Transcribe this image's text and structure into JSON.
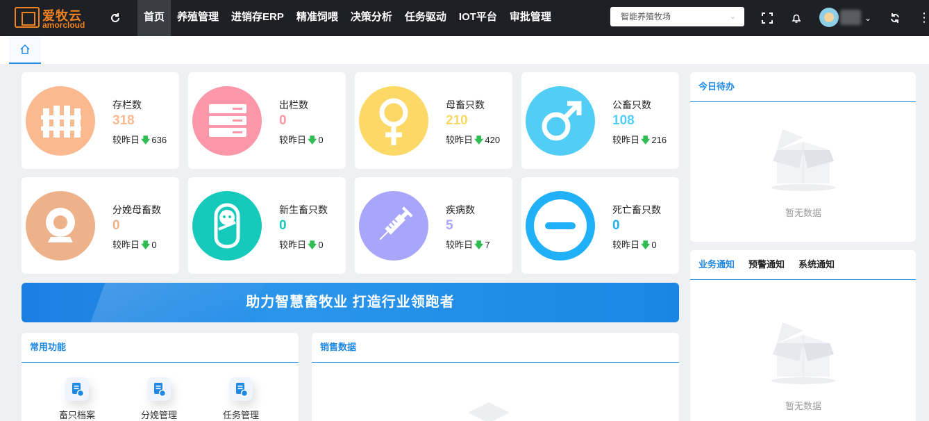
{
  "header": {
    "logo_cn": "爱牧云",
    "logo_en": "amorcloud",
    "nav": [
      "首页",
      "养殖管理",
      "进销存ERP",
      "精准饲喂",
      "决策分析",
      "任务驱动",
      "IOT平台",
      "审批管理"
    ],
    "active_nav": 0,
    "farm_select": "智能养殖牧场"
  },
  "tabs": {
    "home_icon": "home-icon"
  },
  "stats": [
    {
      "label": "存栏数",
      "value": "318",
      "yesterday_label": "较昨日",
      "delta": "636",
      "color": "#fbb98f",
      "icon": "fence-icon"
    },
    {
      "label": "出栏数",
      "value": "0",
      "yesterday_label": "较昨日",
      "delta": "0",
      "color": "#fb97a8",
      "icon": "server-icon"
    },
    {
      "label": "母畜只数",
      "value": "210",
      "yesterday_label": "较昨日",
      "delta": "420",
      "color": "#fcd866",
      "icon": "female-icon"
    },
    {
      "label": "公畜只数",
      "value": "108",
      "yesterday_label": "较昨日",
      "delta": "216",
      "color": "#52cdf6",
      "icon": "male-icon"
    },
    {
      "label": "分娩母畜数",
      "value": "0",
      "yesterday_label": "较昨日",
      "delta": "0",
      "color": "#edb28a",
      "icon": "webcam-icon"
    },
    {
      "label": "新生畜只数",
      "value": "0",
      "yesterday_label": "较昨日",
      "delta": "0",
      "color": "#15c9bb",
      "icon": "baby-icon"
    },
    {
      "label": "疾病数",
      "value": "5",
      "yesterday_label": "较昨日",
      "delta": "7",
      "color": "#a7a6fb",
      "icon": "syringe-icon"
    },
    {
      "label": "死亡畜只数",
      "value": "0",
      "yesterday_label": "较昨日",
      "delta": "0",
      "color": "#1fb0f7",
      "icon": "minus-circle-icon"
    }
  ],
  "banner": {
    "text": "助力智慧畜牧业 打造行业领跑者"
  },
  "common": {
    "title": "常用功能",
    "items": [
      "畜只档案",
      "分娩管理",
      "任务管理"
    ]
  },
  "sales": {
    "title": "销售数据"
  },
  "todo": {
    "title": "今日待办",
    "empty": "暂无数据"
  },
  "notice": {
    "tabs": [
      "业务通知",
      "预警通知",
      "系统通知"
    ],
    "active": 0,
    "empty": "暂无数据"
  }
}
